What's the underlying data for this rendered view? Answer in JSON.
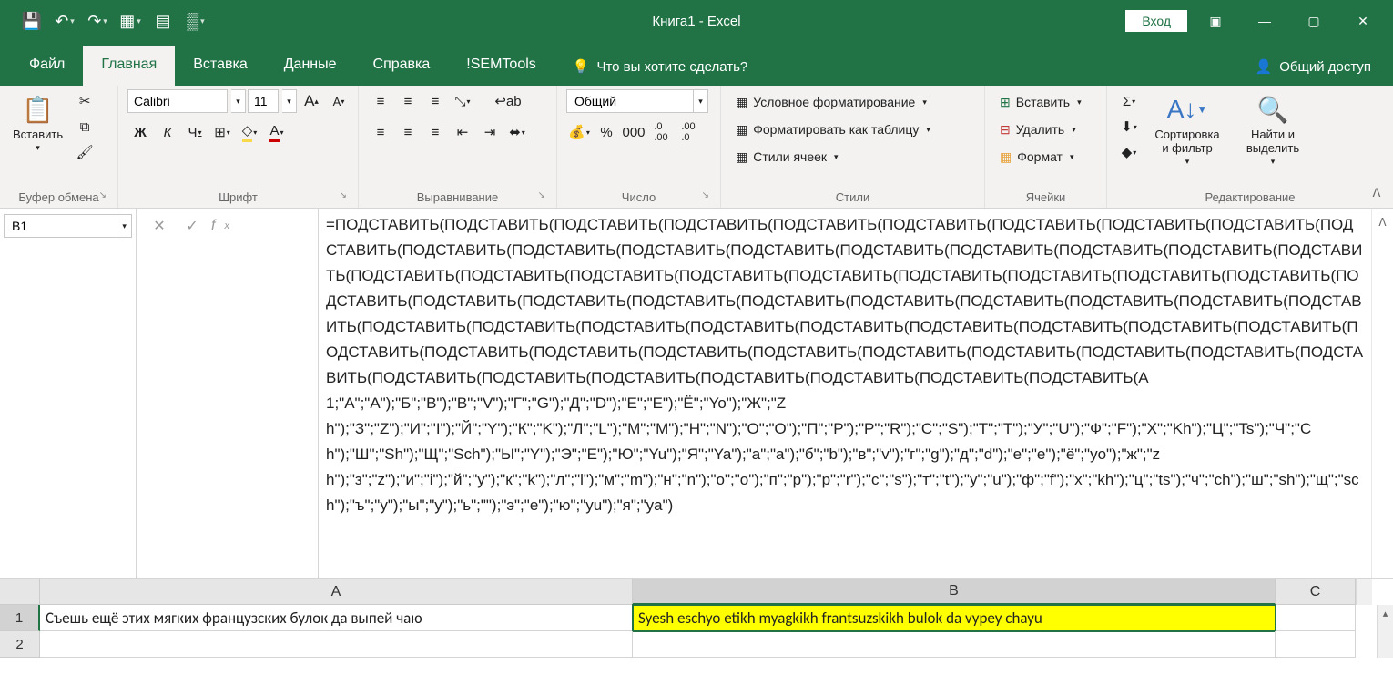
{
  "title": "Книга1  -  Excel",
  "login": "Вход",
  "tabs": {
    "file": "Файл",
    "home": "Главная",
    "insert": "Вставка",
    "data": "Данные",
    "help": "Справка",
    "sem": "!SEMTools"
  },
  "tellme": "Что вы хотите сделать?",
  "share": "Общий доступ",
  "ribbon": {
    "clipboard": {
      "paste": "Вставить",
      "label": "Буфер обмена"
    },
    "font": {
      "name": "Calibri",
      "size": "11",
      "bold": "Ж",
      "italic": "К",
      "underline": "Ч",
      "label": "Шрифт"
    },
    "align": {
      "label": "Выравнивание"
    },
    "number": {
      "format": "Общий",
      "label": "Число"
    },
    "styles": {
      "cond": "Условное форматирование",
      "table": "Форматировать как таблицу",
      "cell": "Стили ячеек",
      "label": "Стили"
    },
    "cells": {
      "insert": "Вставить",
      "delete": "Удалить",
      "format": "Формат",
      "label": "Ячейки"
    },
    "editing": {
      "sort": "Сортировка и фильтр",
      "find": "Найти и выделить",
      "label": "Редактирование"
    }
  },
  "namebox": "B1",
  "formula": "=ПОДСТАВИТЬ(ПОДСТАВИТЬ(ПОДСТАВИТЬ(ПОДСТАВИТЬ(ПОДСТАВИТЬ(ПОДСТАВИТЬ(ПОДСТАВИТЬ(ПОДСТАВИТЬ(ПОДСТАВИТЬ(ПОДСТАВИТЬ(ПОДСТАВИТЬ(ПОДСТАВИТЬ(ПОДСТАВИТЬ(ПОДСТАВИТЬ(ПОДСТАВИТЬ(ПОДСТАВИТЬ(ПОДСТАВИТЬ(ПОДСТАВИТЬ(ПОДСТАВИТЬ(ПОДСТАВИТЬ(ПОДСТАВИТЬ(ПОДСТАВИТЬ(ПОДСТАВИТЬ(ПОДСТАВИТЬ(ПОДСТАВИТЬ(ПОДСТАВИТЬ(ПОДСТАВИТЬ(ПОДСТАВИТЬ(ПОДСТАВИТЬ(ПОДСТАВИТЬ(ПОДСТАВИТЬ(ПОДСТАВИТЬ(ПОДСТАВИТЬ(ПОДСТАВИТЬ(ПОДСТАВИТЬ(ПОДСТАВИТЬ(ПОДСТАВИТЬ(ПОДСТАВИТЬ(ПОДСТАВИТЬ(ПОДСТАВИТЬ(ПОДСТАВИТЬ(ПОДСТАВИТЬ(ПОДСТАВИТЬ(ПОДСТАВИТЬ(ПОДСТАВИТЬ(ПОДСТАВИТЬ(ПОДСТАВИТЬ(ПОДСТАВИТЬ(ПОДСТАВИТЬ(ПОДСТАВИТЬ(ПОДСТАВИТЬ(ПОДСТАВИТЬ(ПОДСТАВИТЬ(ПОДСТАВИТЬ(ПОДСТАВИТЬ(ПОДСТАВИТЬ(ПОДСТАВИТЬ(ПОДСТАВИТЬ(ПОДСТАВИТЬ(ПОДСТАВИТЬ(ПОДСТАВИТЬ(ПОДСТАВИТЬ(ПОДСТАВИТЬ(ПОДСТАВИТЬ(A1;\"А\";\"A\");\"Б\";\"B\");\"В\";\"V\");\"Г\";\"G\");\"Д\";\"D\");\"Е\";\"E\");\"Ё\";\"Yo\");\"Ж\";\"Zh\");\"З\";\"Z\");\"И\";\"I\");\"Й\";\"Y\");\"К\";\"K\");\"Л\";\"L\");\"М\";\"M\");\"Н\";\"N\");\"О\";\"O\");\"П\";\"P\");\"Р\";\"R\");\"С\";\"S\");\"Т\";\"T\");\"У\";\"U\");\"Ф\";\"F\");\"Х\";\"Kh\");\"Ц\";\"Ts\");\"Ч\";\"Ch\");\"Ш\";\"Sh\");\"Щ\";\"Sch\");\"Ы\";\"Y\");\"Э\";\"E\");\"Ю\";\"Yu\");\"Я\";\"Ya\");\"а\";\"a\");\"б\";\"b\");\"в\";\"v\");\"г\";\"g\");\"д\";\"d\");\"е\";\"e\");\"ё\";\"yo\");\"ж\";\"zh\");\"з\";\"z\");\"и\";\"i\");\"й\";\"y\");\"к\";\"k\");\"л\";\"l\");\"м\";\"m\");\"н\";\"n\");\"о\";\"o\");\"п\";\"p\");\"р\";\"r\");\"с\";\"s\");\"т\";\"t\");\"у\";\"u\");\"ф\";\"f\");\"х\";\"kh\");\"ц\";\"ts\");\"ч\";\"ch\");\"ш\";\"sh\");\"щ\";\"sch\");\"ъ\";\"y\");\"ы\";\"y\");\"ь\";\"\");\"э\";\"e\");\"ю\";\"yu\");\"я\";\"ya\")",
  "cols": {
    "A": "A",
    "B": "B",
    "C": "C"
  },
  "rows": {
    "r1": "1",
    "r2": "2"
  },
  "cells": {
    "A1": "Съешь ещё этих мягких французских булок да выпей чаю",
    "B1": "Syesh eschyo etikh myagkikh frantsuzskikh bulok da vypey chayu"
  }
}
